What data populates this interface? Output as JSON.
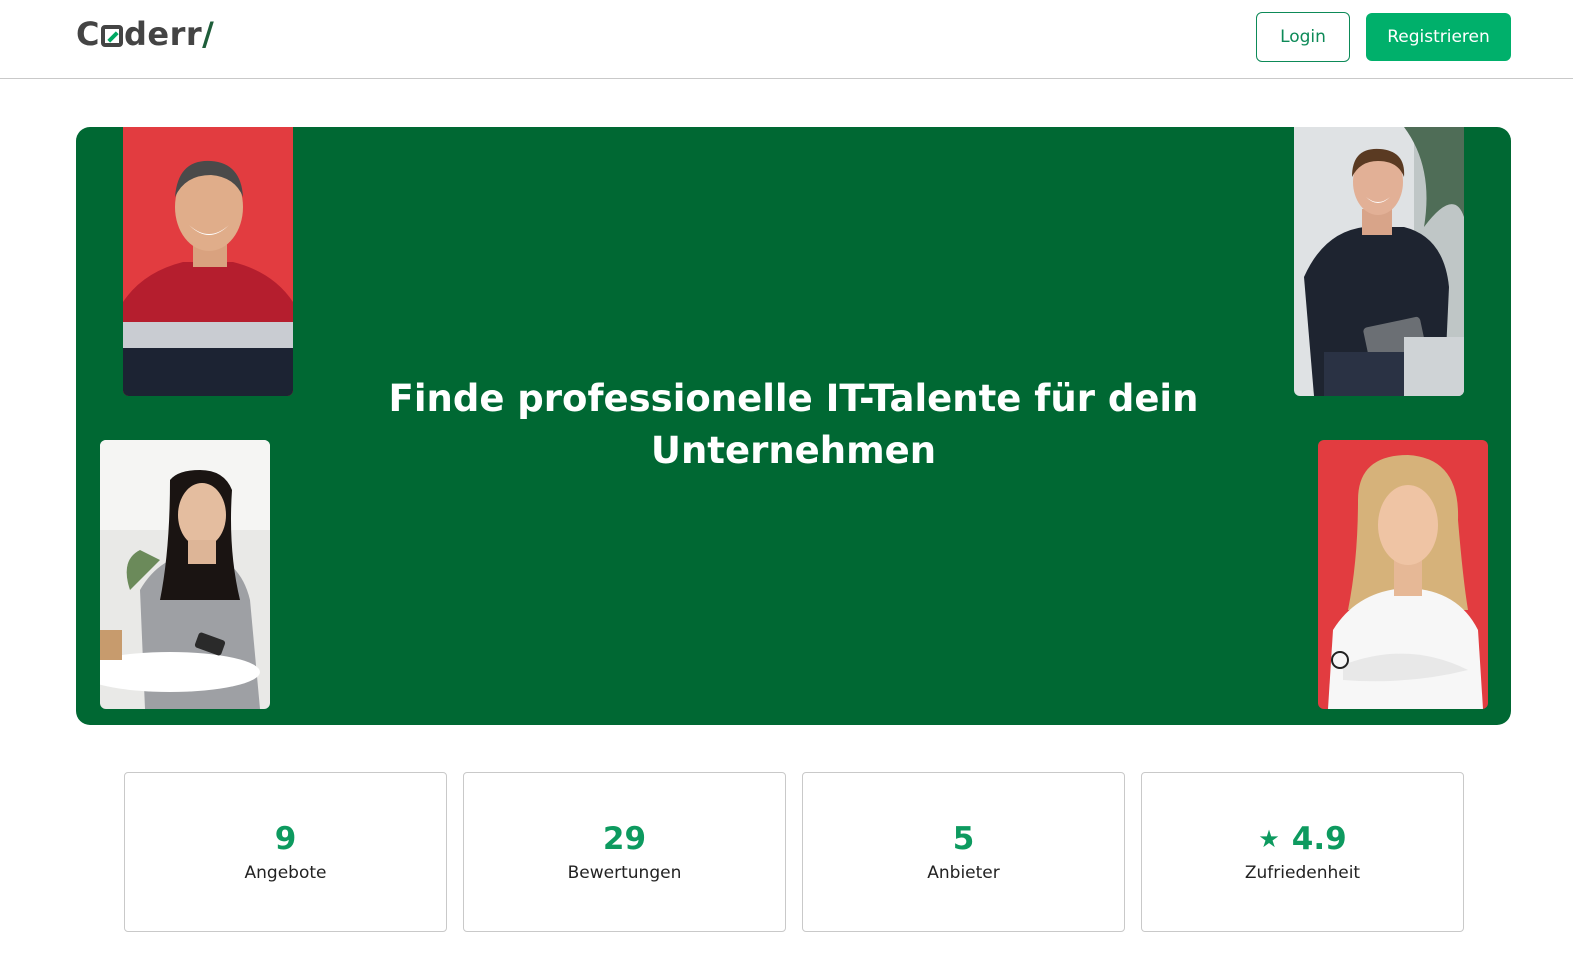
{
  "header": {
    "logo_text": "Coderr/",
    "login_label": "Login",
    "register_label": "Registrieren"
  },
  "hero": {
    "title": "Finde professionelle IT-Talente für dein Unternehmen",
    "photos": [
      "person-photo-man-red-sweater",
      "person-photo-man-tablet",
      "person-photo-woman-phone",
      "person-photo-woman-white-blouse"
    ]
  },
  "stats": [
    {
      "value": "9",
      "label": "Angebote"
    },
    {
      "value": "29",
      "label": "Bewertungen"
    },
    {
      "value": "5",
      "label": "Anbieter"
    },
    {
      "value": "4.9",
      "label": "Zufriedenheit",
      "icon": "star-icon"
    }
  ],
  "colors": {
    "brand_green": "#006833",
    "accent_green": "#00b06b",
    "stat_green": "#0d9a5f",
    "photo_red": "#e23c40"
  }
}
